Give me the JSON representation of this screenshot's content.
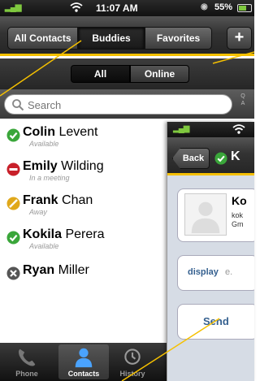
{
  "status_bar": {
    "time": "11:07 AM",
    "battery": "55%"
  },
  "segments": {
    "all_contacts": "All Contacts",
    "buddies": "Buddies",
    "favorites": "Favorites",
    "add": "+"
  },
  "filter": {
    "all": "All",
    "online": "Online"
  },
  "search": {
    "placeholder": "Search",
    "index": [
      "Q",
      "A"
    ]
  },
  "contacts": [
    {
      "first": "Colin",
      "last": "Levent",
      "status": "Available",
      "state": "available"
    },
    {
      "first": "Emily",
      "last": "Wilding",
      "status": "In a meeting",
      "state": "busy"
    },
    {
      "first": "Frank",
      "last": "Chan",
      "status": "Away",
      "state": "away"
    },
    {
      "first": "Kokila",
      "last": "Perera",
      "status": "Available",
      "state": "available"
    },
    {
      "first": "Ryan",
      "last": "Miller",
      "status": "",
      "state": "offline"
    }
  ],
  "tabs": {
    "phone": "Phone",
    "contacts": "Contacts",
    "history": "History"
  },
  "detail": {
    "back": "Back",
    "title": "K",
    "name": "Ko",
    "line1": "kok",
    "line2": "Gm",
    "field_label": "display",
    "field_value": "e.",
    "send": "Send"
  },
  "colors": {
    "accent": "#f5c000",
    "available": "#3aa63a",
    "busy": "#c8202a",
    "away": "#e0a81a",
    "link": "#35608f"
  }
}
